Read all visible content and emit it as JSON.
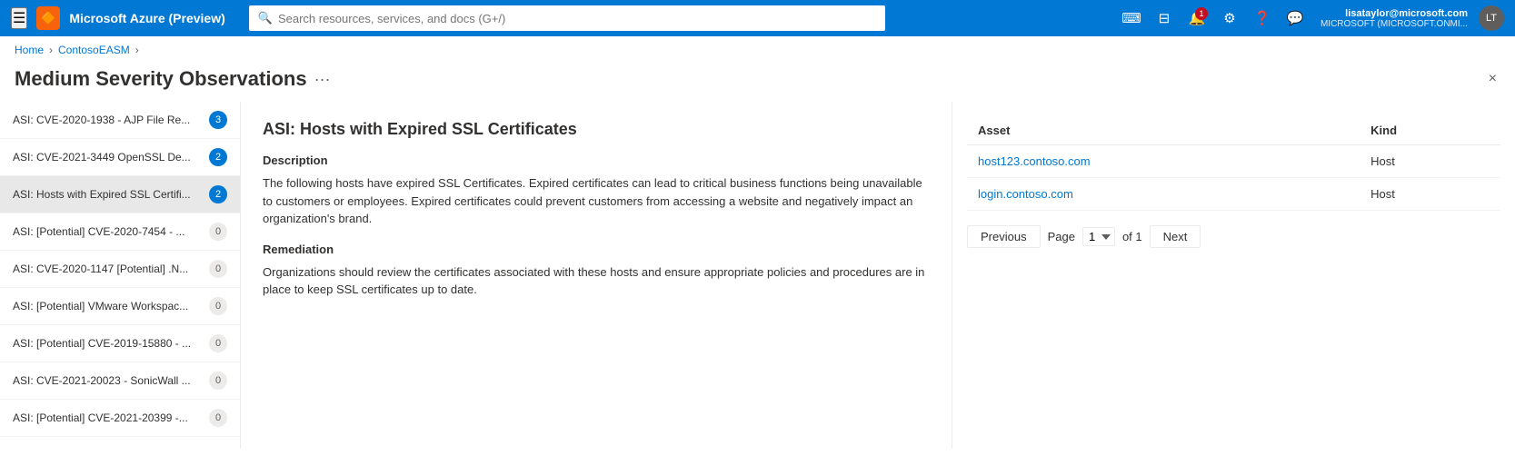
{
  "topbar": {
    "app_title": "Microsoft Azure (Preview)",
    "search_placeholder": "Search resources, services, and docs (G+/)",
    "notification_count": "1",
    "user_name": "lisataylor@microsoft.com",
    "user_domain": "MICROSOFT (MICROSOFT.ONMI...",
    "user_initials": "LT"
  },
  "breadcrumb": {
    "home": "Home",
    "resource": "ContosoEASM"
  },
  "page": {
    "title": "Medium Severity Observations",
    "more_label": "···",
    "close_label": "×"
  },
  "sidebar_items": [
    {
      "label": "ASI: CVE-2020-1938 - AJP File Re...",
      "count": "3",
      "zero": false,
      "active": false
    },
    {
      "label": "ASI: CVE-2021-3449 OpenSSL De...",
      "count": "2",
      "zero": false,
      "active": false
    },
    {
      "label": "ASI: Hosts with Expired SSL Certifi...",
      "count": "2",
      "zero": false,
      "active": true
    },
    {
      "label": "ASI: [Potential] CVE-2020-7454 - ...",
      "count": "0",
      "zero": true,
      "active": false
    },
    {
      "label": "ASI: CVE-2020-1147 [Potential] .N...",
      "count": "0",
      "zero": true,
      "active": false
    },
    {
      "label": "ASI: [Potential] VMware Workspac...",
      "count": "0",
      "zero": true,
      "active": false
    },
    {
      "label": "ASI: [Potential] CVE-2019-15880 - ...",
      "count": "0",
      "zero": true,
      "active": false
    },
    {
      "label": "ASI: CVE-2021-20023 - SonicWall ...",
      "count": "0",
      "zero": true,
      "active": false
    },
    {
      "label": "ASI: [Potential] CVE-2021-20399 -...",
      "count": "0",
      "zero": true,
      "active": false
    }
  ],
  "detail": {
    "title": "ASI: Hosts with Expired SSL Certificates",
    "description_heading": "Description",
    "description_body": "The following hosts have expired SSL Certificates. Expired certificates can lead to critical business functions being unavailable to customers or employees. Expired certificates could prevent customers from accessing a website and negatively impact an organization's brand.",
    "remediation_heading": "Remediation",
    "remediation_body": "Organizations should review the certificates associated with these hosts and ensure appropriate policies and procedures are in place to keep SSL certificates up to date."
  },
  "table": {
    "col_asset": "Asset",
    "col_kind": "Kind",
    "rows": [
      {
        "asset": "host123.contoso.com",
        "kind": "Host"
      },
      {
        "asset": "login.contoso.com",
        "kind": "Host"
      }
    ]
  },
  "pagination": {
    "previous_label": "Previous",
    "next_label": "Next",
    "page_label": "Page",
    "of_label": "of 1",
    "current_page": "1"
  }
}
